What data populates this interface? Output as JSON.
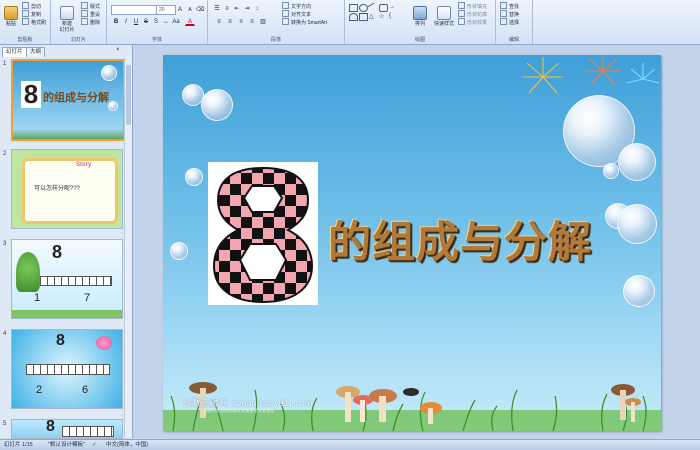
{
  "ribbon": {
    "clipboard": {
      "paste": "粘贴",
      "cut": "剪切",
      "copy": "复制",
      "format_painter": "格式刷",
      "group": "剪贴板"
    },
    "slides": {
      "new_slide": "新建\n幻灯片",
      "layout": "版式",
      "reset": "重设",
      "delete": "删除",
      "group": "幻灯片"
    },
    "font": {
      "name_value": "",
      "size_value": "20",
      "group": "字体"
    },
    "paragraph": {
      "text_direction": "文字方向",
      "align_text": "对齐文本",
      "smartart": "转换为 SmartArt",
      "group": "段落"
    },
    "drawing": {
      "arrange": "排列",
      "quick_styles": "快速样式",
      "shape_fill": "形状填充",
      "shape_outline": "形状轮廓",
      "shape_effects": "形状效果",
      "group": "绘图"
    },
    "editing": {
      "find": "查找",
      "replace": "替换",
      "select": "选择",
      "group": "编辑"
    }
  },
  "panel": {
    "tab_slides": "幻灯片",
    "tab_outline": "大纲",
    "thumbnails": [
      {
        "num": "1",
        "title": "的组成与分解"
      },
      {
        "num": "2",
        "title": "可以怎样分呢???"
      },
      {
        "num": "3",
        "top": "8",
        "left": "1",
        "right": "7"
      },
      {
        "num": "4",
        "top": "8",
        "left": "2",
        "right": "6"
      },
      {
        "num": "5",
        "top": "8"
      }
    ]
  },
  "slide": {
    "title": "的组成与分解",
    "digit": "8",
    "watermark": "幼教资源网 ziyuan.baby611.com",
    "watermark_sub": "本课件由 幼教资源网 收集整理 欢迎使用"
  },
  "status": {
    "slide_info": "幻灯片 1/15",
    "theme": "\"默认设计模板\"",
    "language": "中文(简体，中国)"
  },
  "colors": {
    "accent": "#3f9fd8",
    "selection": "#f0a030",
    "title": "#b07a3a"
  }
}
